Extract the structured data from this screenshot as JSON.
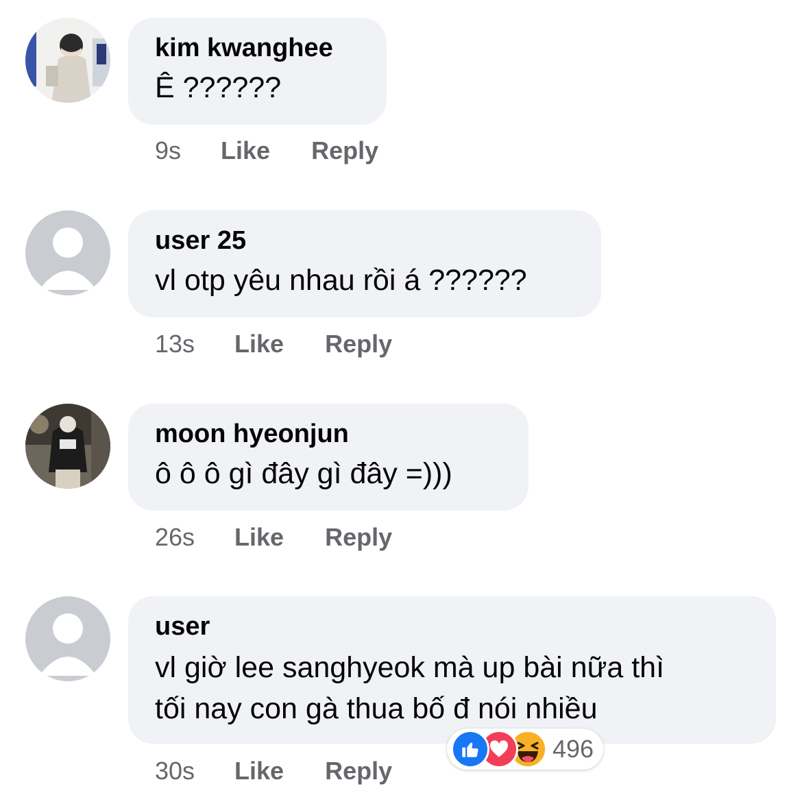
{
  "comments": [
    {
      "author": "kim kwanghee",
      "text": "Ê ??????",
      "time": "9s",
      "like_label": "Like",
      "reply_label": "Reply",
      "avatar_icon": "photo-avatar-icon"
    },
    {
      "author": "user 25",
      "text": "vl otp yêu nhau rồi á ??????",
      "time": "13s",
      "like_label": "Like",
      "reply_label": "Reply",
      "avatar_icon": "default-avatar-icon"
    },
    {
      "author": "moon hyeonjun",
      "text": "ô ô ô gì đây gì đây =)))",
      "time": "26s",
      "like_label": "Like",
      "reply_label": "Reply",
      "avatar_icon": "photo-avatar-icon"
    },
    {
      "author": "user",
      "text_lines": [
        "vl giờ lee sanghyeok mà up bài nữa thì",
        "tối nay con gà thua bố đ nói nhiều"
      ],
      "time": "30s",
      "like_label": "Like",
      "reply_label": "Reply",
      "avatar_icon": "default-avatar-icon",
      "reactions": {
        "icons": [
          "like-reaction-icon",
          "love-reaction-icon",
          "haha-reaction-icon"
        ],
        "count": "496"
      }
    }
  ],
  "colors": {
    "bubble": "#f0f2f5",
    "meta_text": "#65676b",
    "like_blue": "#1877f2",
    "love_red": "#f33e58",
    "haha_yellow": "#f7b125"
  }
}
